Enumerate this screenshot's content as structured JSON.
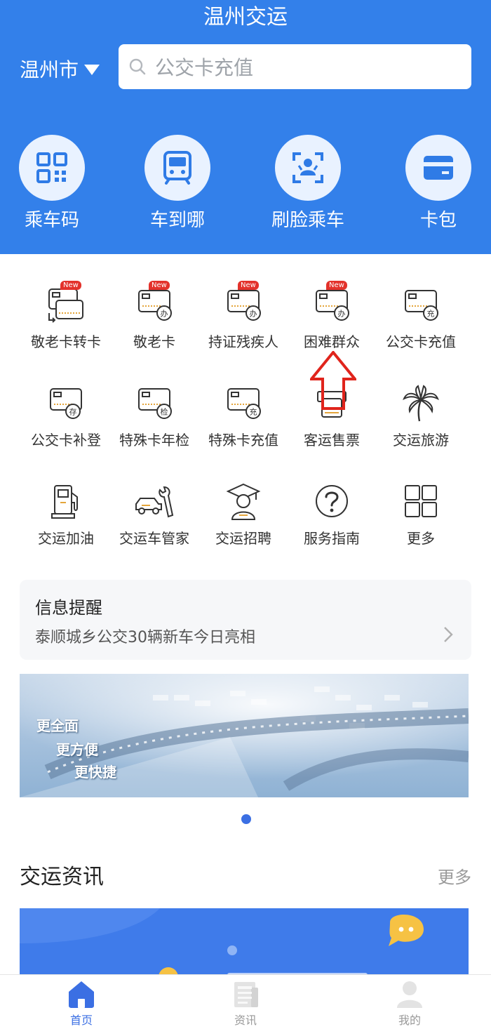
{
  "header": {
    "title": "温州交运",
    "city": "温州市",
    "search_placeholder": "公交卡充值"
  },
  "quick_actions": [
    {
      "label": "乘车码",
      "icon": "qr-code-icon"
    },
    {
      "label": "车到哪",
      "icon": "bus-front-icon"
    },
    {
      "label": "刷脸乘车",
      "icon": "face-scan-icon"
    },
    {
      "label": "卡包",
      "icon": "card-wallet-icon"
    }
  ],
  "services": [
    {
      "label": "敬老卡转卡",
      "icon": "card-transfer-icon",
      "badge": "New"
    },
    {
      "label": "敬老卡",
      "icon": "card-apply-icon",
      "badge": "New"
    },
    {
      "label": "持证残疾人",
      "icon": "card-apply-icon",
      "badge": "New"
    },
    {
      "label": "困难群众",
      "icon": "card-apply-icon",
      "badge": "New"
    },
    {
      "label": "公交卡充值",
      "icon": "card-recharge-icon",
      "mark": "充"
    },
    {
      "label": "公交卡补登",
      "icon": "card-deposit-icon",
      "mark": "存"
    },
    {
      "label": "特殊卡年检",
      "icon": "card-inspect-icon",
      "mark": "检"
    },
    {
      "label": "特殊卡充值",
      "icon": "card-recharge-icon",
      "mark": "充"
    },
    {
      "label": "客运售票",
      "icon": "ticket-icon"
    },
    {
      "label": "交运旅游",
      "icon": "palm-tree-icon"
    },
    {
      "label": "交运加油",
      "icon": "fuel-pump-icon"
    },
    {
      "label": "交运车管家",
      "icon": "car-wrench-icon"
    },
    {
      "label": "交运招聘",
      "icon": "graduate-icon"
    },
    {
      "label": "服务指南",
      "icon": "question-icon"
    },
    {
      "label": "更多",
      "icon": "grid-icon"
    }
  ],
  "card_mark_apply": "办",
  "notice": {
    "title": "信息提醒",
    "text": "泰顺城乡公交30辆新车今日亮相"
  },
  "banner": {
    "slogans": [
      "更全面",
      "更方便",
      "更快捷"
    ],
    "active_page": 1,
    "page_count": 1
  },
  "news": {
    "title": "交运资讯",
    "more": "更多"
  },
  "tabs": [
    {
      "label": "首页",
      "icon": "home-icon",
      "active": true
    },
    {
      "label": "资讯",
      "icon": "news-icon",
      "active": false
    },
    {
      "label": "我的",
      "icon": "person-icon",
      "active": false
    }
  ],
  "colors": {
    "brand_blue": "#3380ea",
    "badge_red": "#e3322b",
    "arrow_red": "#e0241c",
    "active_tab": "#3b6fe3"
  }
}
